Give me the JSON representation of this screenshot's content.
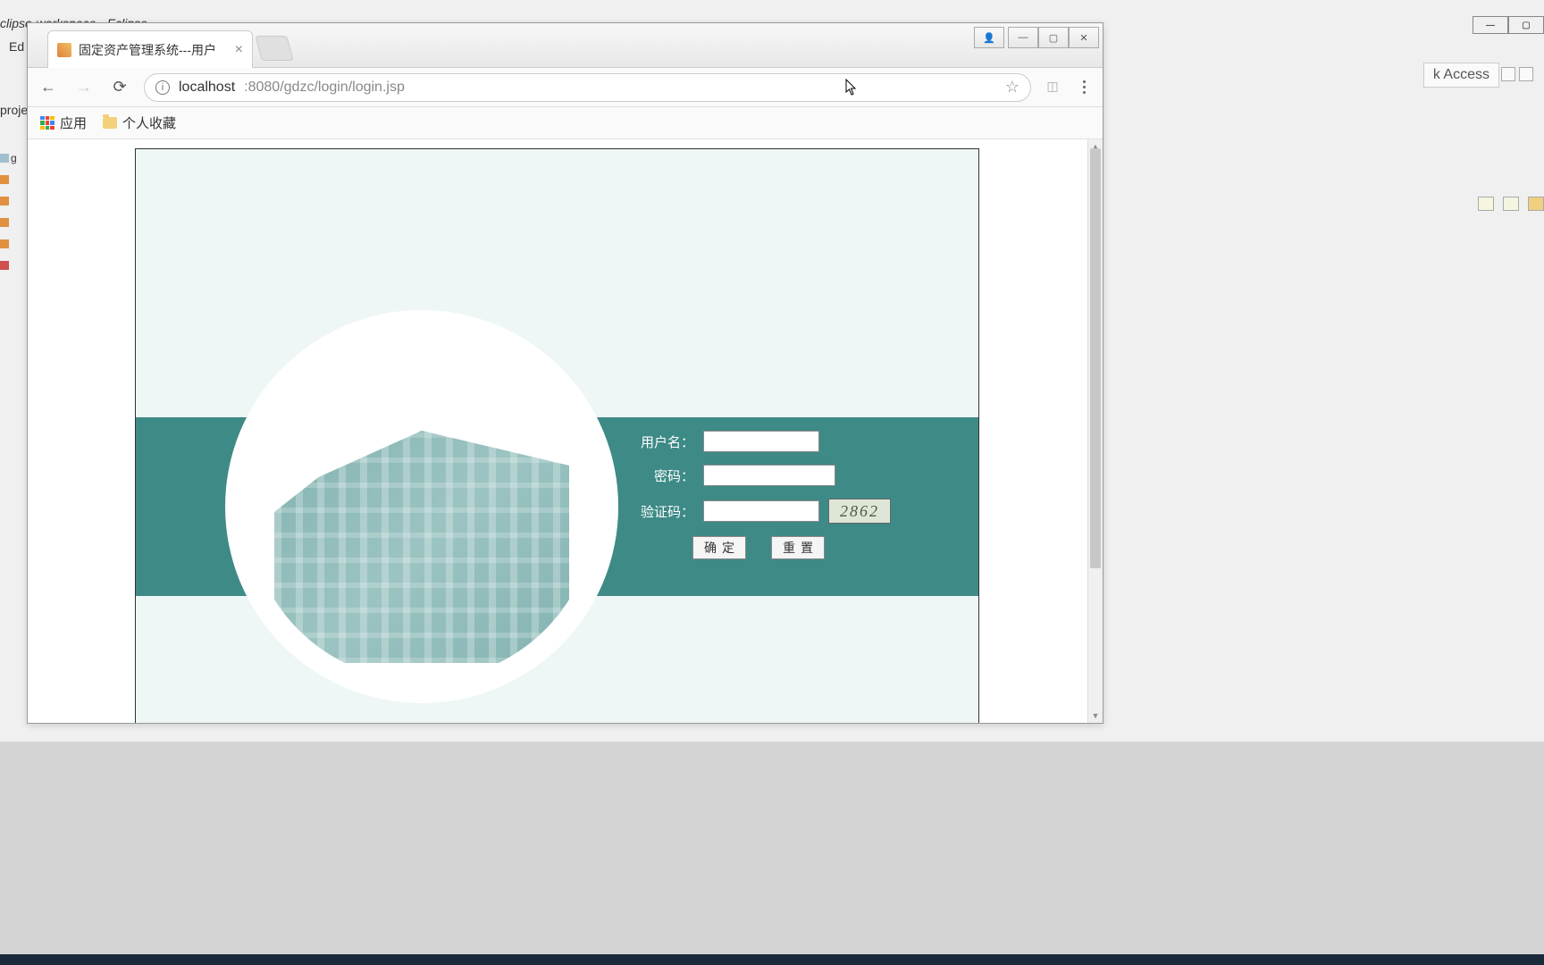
{
  "eclipse": {
    "title": "clipse-workspace - Eclipse",
    "menu_edit": "Ed",
    "projects_label": "proje",
    "tree_item": "g",
    "quick_access": "k Access"
  },
  "browser": {
    "tab_title": "固定资产管理系统---用户",
    "url_host": "localhost",
    "url_port_path": ":8080/gdzc/login/login.jsp",
    "bookmarks": {
      "apps": "应用",
      "personal": "个人收藏"
    }
  },
  "login": {
    "username_label": "用户名：",
    "password_label": "密码：",
    "captcha_label": "验证码：",
    "captcha_value": "2862",
    "submit": "确定",
    "reset": "重置"
  }
}
